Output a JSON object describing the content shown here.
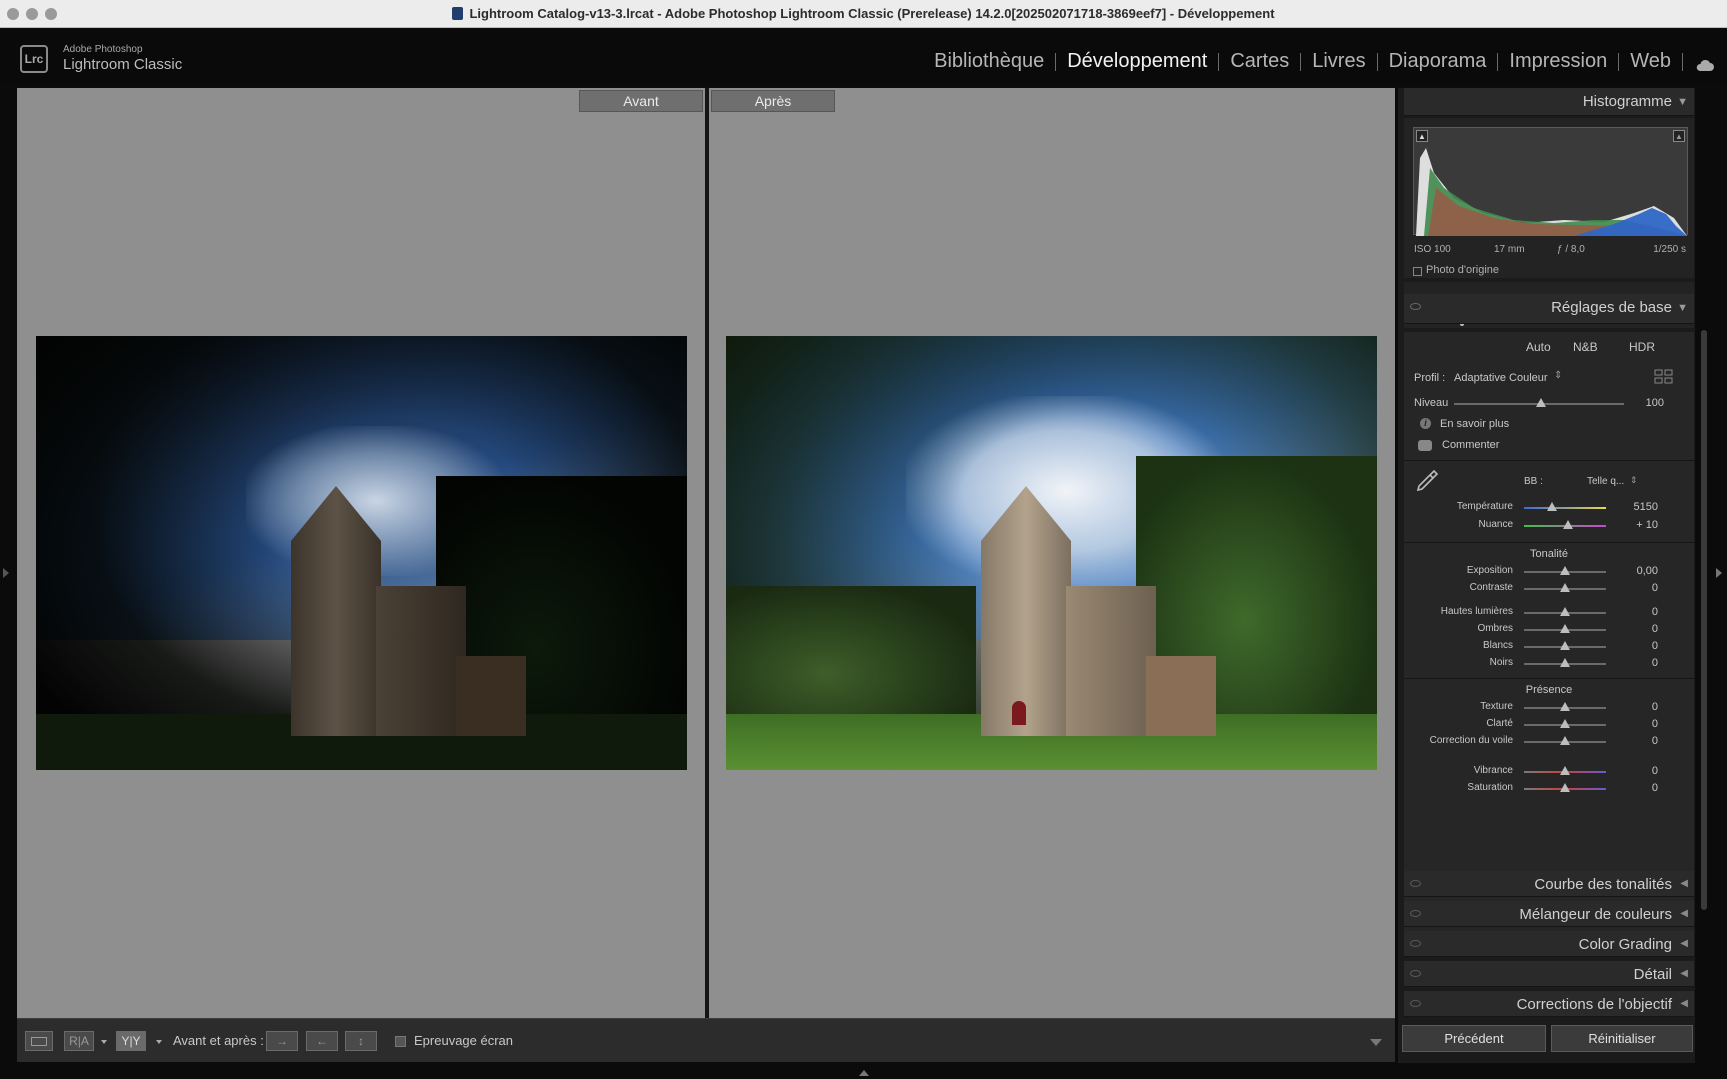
{
  "window": {
    "title": "Lightroom Catalog-v13-3.lrcat - Adobe Photoshop Lightroom Classic (Prerelease) 14.2.0[202502071718-3869eef7] - Développement"
  },
  "logo": {
    "badge": "Lrc",
    "top": "Adobe Photoshop",
    "bottom": "Lightroom Classic"
  },
  "modules": [
    "Bibliothèque",
    "Développement",
    "Cartes",
    "Livres",
    "Diaporama",
    "Impression",
    "Web"
  ],
  "view": {
    "before_label": "Avant",
    "after_label": "Après"
  },
  "toolbar": {
    "mode_ra": "R|A",
    "mode_yy": "Y|Y",
    "before_after_label": "Avant et après :",
    "proof_label": "Epreuvage écran"
  },
  "histogram": {
    "title": "Histogramme",
    "iso": "ISO 100",
    "focal": "17 mm",
    "aperture": "ƒ / 8,0",
    "shutter": "1/250 s",
    "original_photo": "Photo d'origine"
  },
  "basic": {
    "title": "Réglages de base",
    "auto": "Auto",
    "nb": "N&B",
    "hdr": "HDR",
    "profile_label": "Profil :",
    "profile_value": "Adaptative Couleur",
    "amount_label": "Niveau",
    "amount_value": "100",
    "learn_more": "En savoir plus",
    "comment": "Commenter",
    "wb_label": "BB :",
    "wb_value": "Telle q...",
    "temp_label": "Température",
    "temp_value": "5150",
    "tint_label": "Nuance",
    "tint_value": "+ 10",
    "tone_title": "Tonalité",
    "presence_title": "Présence",
    "tone_sliders": [
      {
        "label": "Exposition",
        "value": "0,00"
      },
      {
        "label": "Contraste",
        "value": "0"
      },
      {
        "label": "Hautes lumières",
        "value": "0"
      },
      {
        "label": "Ombres",
        "value": "0"
      },
      {
        "label": "Blancs",
        "value": "0"
      },
      {
        "label": "Noirs",
        "value": "0"
      }
    ],
    "presence_sliders": [
      {
        "label": "Texture",
        "value": "0"
      },
      {
        "label": "Clarté",
        "value": "0"
      },
      {
        "label": "Correction du voile",
        "value": "0"
      },
      {
        "label": "Vibrance",
        "value": "0"
      },
      {
        "label": "Saturation",
        "value": "0"
      }
    ]
  },
  "collapsed_panels": [
    "Courbe des tonalités",
    "Mélangeur de couleurs",
    "Color Grading",
    "Détail",
    "Corrections de l'objectif"
  ],
  "footer_buttons": {
    "previous": "Précédent",
    "reset": "Réinitialiser"
  },
  "colors": {
    "accent": "#f2f2f2",
    "panel": "#262626",
    "main_bg": "#8f8f8f"
  }
}
